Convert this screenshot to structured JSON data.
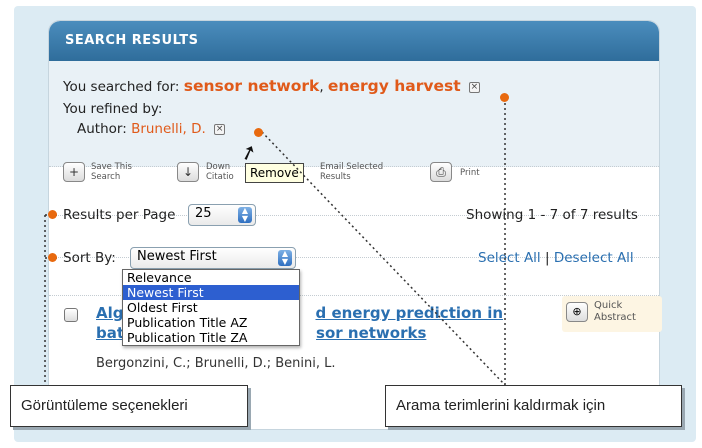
{
  "header": {
    "title": "SEARCH RESULTS"
  },
  "search": {
    "searched_label": "You searched for:",
    "term1": "sensor network",
    "separator": ",",
    "term2": "energy harvest",
    "refined_label": "You refined by:",
    "author_label": "Author:",
    "author_value": "Brunelli, D."
  },
  "toolbar": {
    "save_line1": "Save This",
    "save_line2": "Search",
    "download_line1": "Down",
    "download_line2": "Citatio",
    "email_line1": "Email Selected",
    "email_line2": "Results",
    "print_label": "Print"
  },
  "tooltip": {
    "text": "Remove"
  },
  "results_per_page": {
    "label": "Results per Page",
    "value": "25"
  },
  "showing": "Showing 1 - 7 of 7 results",
  "sort": {
    "label": "Sort By:",
    "value": "Newest First",
    "options": [
      "Relevance",
      "Newest First",
      "Oldest First",
      "Publication Title AZ",
      "Publication Title ZA"
    ]
  },
  "select_all": "Select All",
  "select_sep": "|",
  "deselect_all": "Deselect All",
  "result": {
    "title_visible_a": "Alg",
    "title_visible_b": "d energy prediction in",
    "title_line2_a": "bat",
    "title_line2_b": "sor networks",
    "authors": "Bergonzini, C.; Brunelli, D.; Benini, L."
  },
  "quick_abstract": {
    "line1": "Quick",
    "line2": "Abstract"
  },
  "callouts": {
    "left": "Görüntüleme seçenekleri",
    "right": "Arama terimlerini kaldırmak için"
  },
  "colors": {
    "accent": "#e05a1a",
    "header": "#3a7aa9",
    "link": "#2a6fb0",
    "dot": "#e8690e"
  }
}
